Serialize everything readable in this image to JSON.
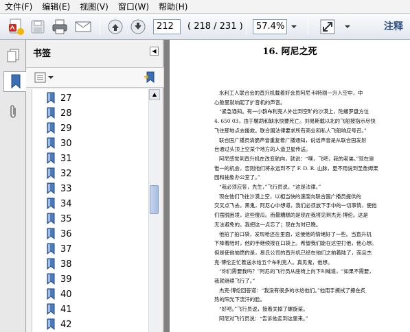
{
  "menu": [
    "文件(F)",
    "编辑(E)",
    "视图(V)",
    "窗口(W)",
    "帮助(H)"
  ],
  "toolbar": {
    "page_input": "212",
    "page_count": "( 218 / 231 )",
    "zoom": "57.4%",
    "comment_label": "注释"
  },
  "panel": {
    "title": "书签",
    "bookmarks": [
      "27",
      "28",
      "29",
      "30",
      "31",
      "32",
      "33",
      "34",
      "35",
      "36",
      "37",
      "38",
      "39",
      "40",
      "41",
      "42"
    ]
  },
  "document": {
    "chapter_title": "16. 阿尼之死",
    "paragraphs": [
      "水利工人联合会的直升机载着好会员阿尼·科特刚一升入空中，中",
      "心舱里就响起了扩音机的声音。",
      "“紧急通知。有一小群布利克人外出到空旷的沙漠上，陀螺罗盘方位",
      "4. 650 03，由于騾鹉和缺水快要死亡。刘易斯载以北的飞船按指示尽快",
      "飞往那地点去援救。联合国法律要求所有商业和私人飞船响应号召。”",
      "联合国广播员清脆声音重复着广播通知，说话声音是从联合国发射",
      "台通过头顶上空某个地方的人造卫星传送。",
      "阿尼感觉到直升机在改变航向，就说：“嘿，飞吧，我的老弟。”现在是",
      "惟一的机会，否则他们将永远到不了 F. D. R. 山脉，更不用说到圣詹姆果",
      "园和抽象办公室了。”",
      "“我必须应答，先生，”飞行员说，“这是法律。”",
      "现在他们飞往沙漠上空，以相当快的速度向联合国广播员提供的",
      "交叉点飞去。黑鬼，阿尼心中想道，我们必须放下手中的一切事情，使他",
      "们摆脱困境，这些傻瓜。而最糟糕的是现在我将见到杰克·博伦。这是",
      "无法避免的。我把这一点忘了；现在为时已晚。",
      "他拍了拍口袋，发现枪还在里面，这使他的情绪好了一些。当直升机",
      "下降着陆时，他的手继续按在口袋上。希望我们能在这里打他，他心想。",
      "但是使他恼愤的是，易氏公司的直升机已经在他们之前着陆了，而且杰",
      "克·博伦正忙着送水给五个布利克人。真见鬼，他想。",
      "“你们需要我吗？”阿尼的飞行员从座椅上向下叫喊道，“如果不需要，",
      "我就继续飞行了。”",
      "杰克·博伦回答道：“我没有很多的水给他们。”他用手擦拭了擦在炙",
      "热的阳光下流汗的脸。",
      "“好吧。”飞行员说，接着关掉了螺旋桨。",
      "阿尼对飞行员说：“告诉他走到这里来。”"
    ]
  }
}
